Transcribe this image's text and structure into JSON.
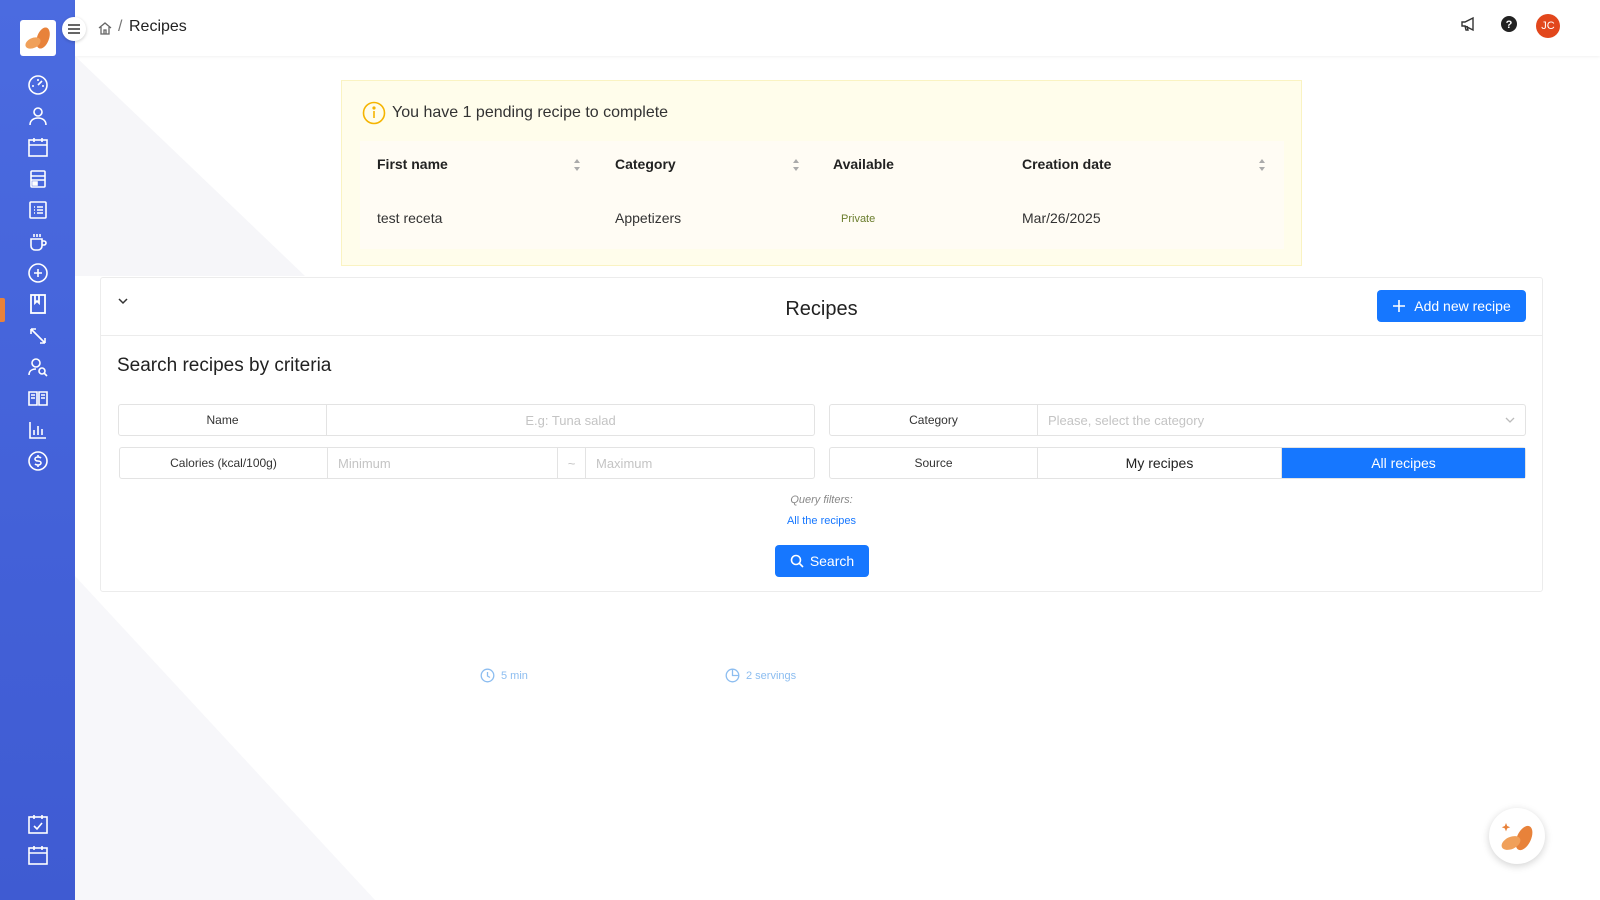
{
  "topbar": {
    "breadcrumb_separator": "/",
    "title": "Recipes",
    "avatar_initials": "JC",
    "icons": [
      "megaphone-icon",
      "help-icon"
    ]
  },
  "sidebar": {
    "items": [
      {
        "icon": "dashboard-icon"
      },
      {
        "icon": "user-icon"
      },
      {
        "icon": "calendar-icon"
      },
      {
        "icon": "layout-icon"
      },
      {
        "icon": "list-icon"
      },
      {
        "icon": "cup-icon"
      },
      {
        "icon": "add-circle-icon"
      },
      {
        "icon": "recipe-book-icon",
        "active": true
      },
      {
        "icon": "resize-icon"
      },
      {
        "icon": "user-search-icon"
      },
      {
        "icon": "open-book-icon"
      },
      {
        "icon": "bar-chart-icon"
      },
      {
        "icon": "dollar-icon"
      }
    ],
    "bottom_items": [
      {
        "icon": "calendar-check-icon"
      },
      {
        "icon": "calendar-icon"
      }
    ]
  },
  "pending": {
    "message": "You have 1 pending recipe to complete",
    "columns": [
      "First name",
      "Category",
      "Available",
      "Creation date"
    ],
    "rows": [
      {
        "first_name": "test receta",
        "category": "Appetizers",
        "available": "Private",
        "creation_date": "Mar/26/2025"
      }
    ]
  },
  "recipes_panel": {
    "title": "Recipes",
    "add_button": "Add new recipe",
    "search_title": "Search recipes by criteria",
    "name_label": "Name",
    "name_placeholder": "E.g: Tuna salad",
    "category_label": "Category",
    "category_placeholder": "Please, select the category",
    "calories_label": "Calories (kcal/100g)",
    "calories_min_placeholder": "Minimum",
    "calories_separator": "~",
    "calories_max_placeholder": "Maximum",
    "source_label": "Source",
    "source_options": [
      "My recipes",
      "All recipes"
    ],
    "source_selected": "All recipes",
    "query_filters_label": "Query filters:",
    "query_filters_value": "All the recipes",
    "search_button": "Search"
  },
  "recipe_meta": {
    "time": "5 min",
    "servings": "2 servings"
  },
  "colors": {
    "sidebar": "#4361d8",
    "primary": "#1677ff",
    "accent": "#e8823a",
    "pending_bg": "#fffdeb",
    "avatar": "#e2471c"
  }
}
